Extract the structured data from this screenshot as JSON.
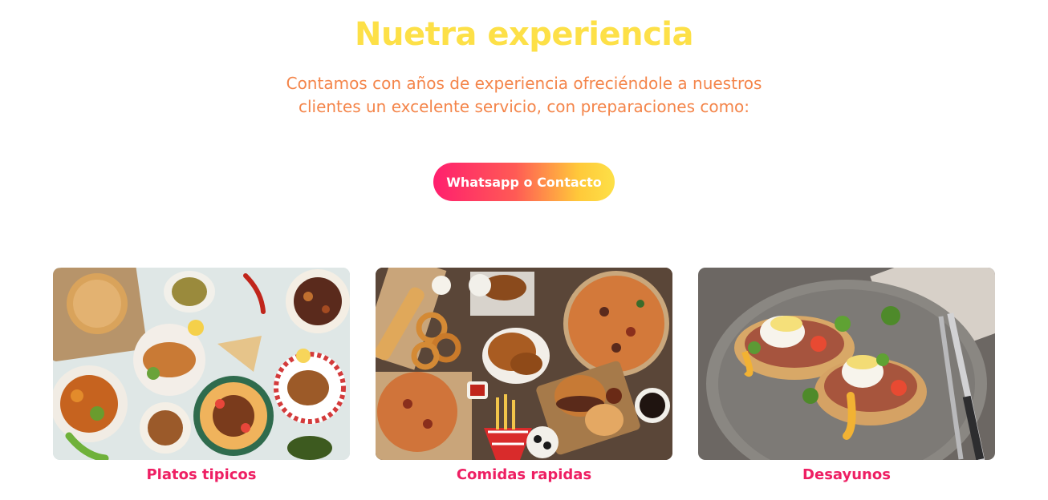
{
  "header": {
    "title": "Nuetra experiencia",
    "description": "Contamos con años de experiencia ofreciéndole a nuestros clientes un excelente servicio, con preparaciones como:"
  },
  "cta": {
    "label": "Whatsapp o Contacto"
  },
  "cards": [
    {
      "label": "Platos tipicos",
      "image": "traditional-dishes-photo"
    },
    {
      "label": "Comidas rapidas",
      "image": "fast-food-photo"
    },
    {
      "label": "Desayunos",
      "image": "breakfast-eggs-benedict-photo"
    }
  ],
  "colors": {
    "title": "#fde047",
    "subtitle": "#f4854a",
    "label": "#ee1f63",
    "button_gradient": [
      "#ff1f6e",
      "#fde047"
    ]
  }
}
